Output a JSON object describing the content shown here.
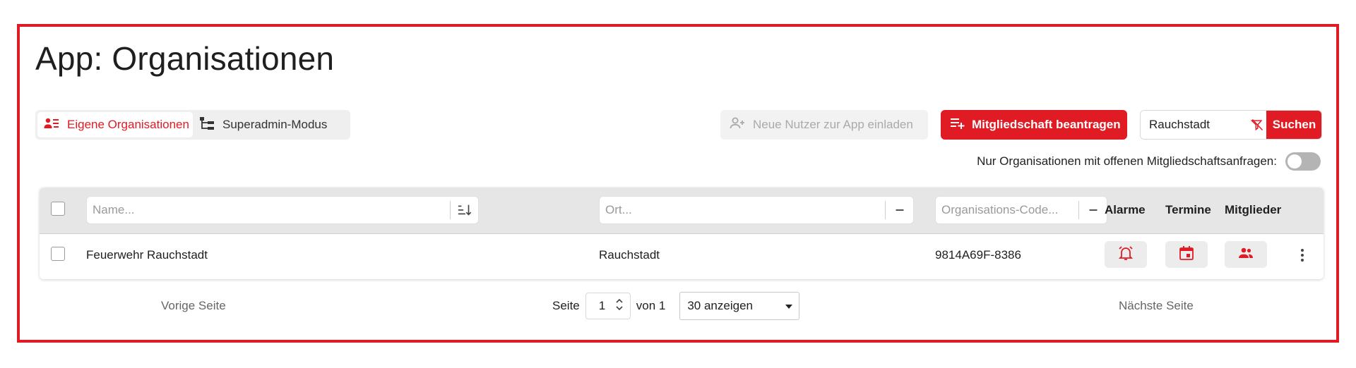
{
  "page": {
    "title": "App: Organisationen"
  },
  "modes": [
    {
      "label": "Eigene Organisationen",
      "icon": "person-list-icon",
      "active": true
    },
    {
      "label": "Superadmin-Modus",
      "icon": "tree-structure-icon",
      "active": false
    }
  ],
  "toolbar": {
    "invite_label": "Neue Nutzer zur App einladen",
    "invite_icon": "person-add-icon",
    "membership_label": "Mitgliedschaft beantragen",
    "membership_icon": "playlist-add-icon"
  },
  "search": {
    "value": "Rauchstadt",
    "button_label": "Suchen",
    "clear_icon": "filter-off-icon"
  },
  "filter_toggle": {
    "label": "Nur Organisationen mit offenen Mitgliedschaftsanfragen:",
    "on": false
  },
  "table": {
    "filters": {
      "name_placeholder": "Name...",
      "ort_placeholder": "Ort...",
      "code_placeholder": "Organisations-Code..."
    },
    "columns": {
      "alarme": "Alarme",
      "termine": "Termine",
      "mitglieder": "Mitglieder"
    },
    "rows": [
      {
        "name": "Feuerwehr Rauchstadt",
        "ort": "Rauchstadt",
        "code": "9814A69F-8386"
      }
    ]
  },
  "pagination": {
    "prev_label": "Vorige Seite",
    "next_label": "Nächste Seite",
    "page_label": "Seite",
    "current_page": "1",
    "of_label": "von 1",
    "page_size_label": "30 anzeigen"
  },
  "colors": {
    "accent": "#e01b24",
    "header_bg": "#e6e6e6",
    "muted_text": "#9a9a9a"
  }
}
